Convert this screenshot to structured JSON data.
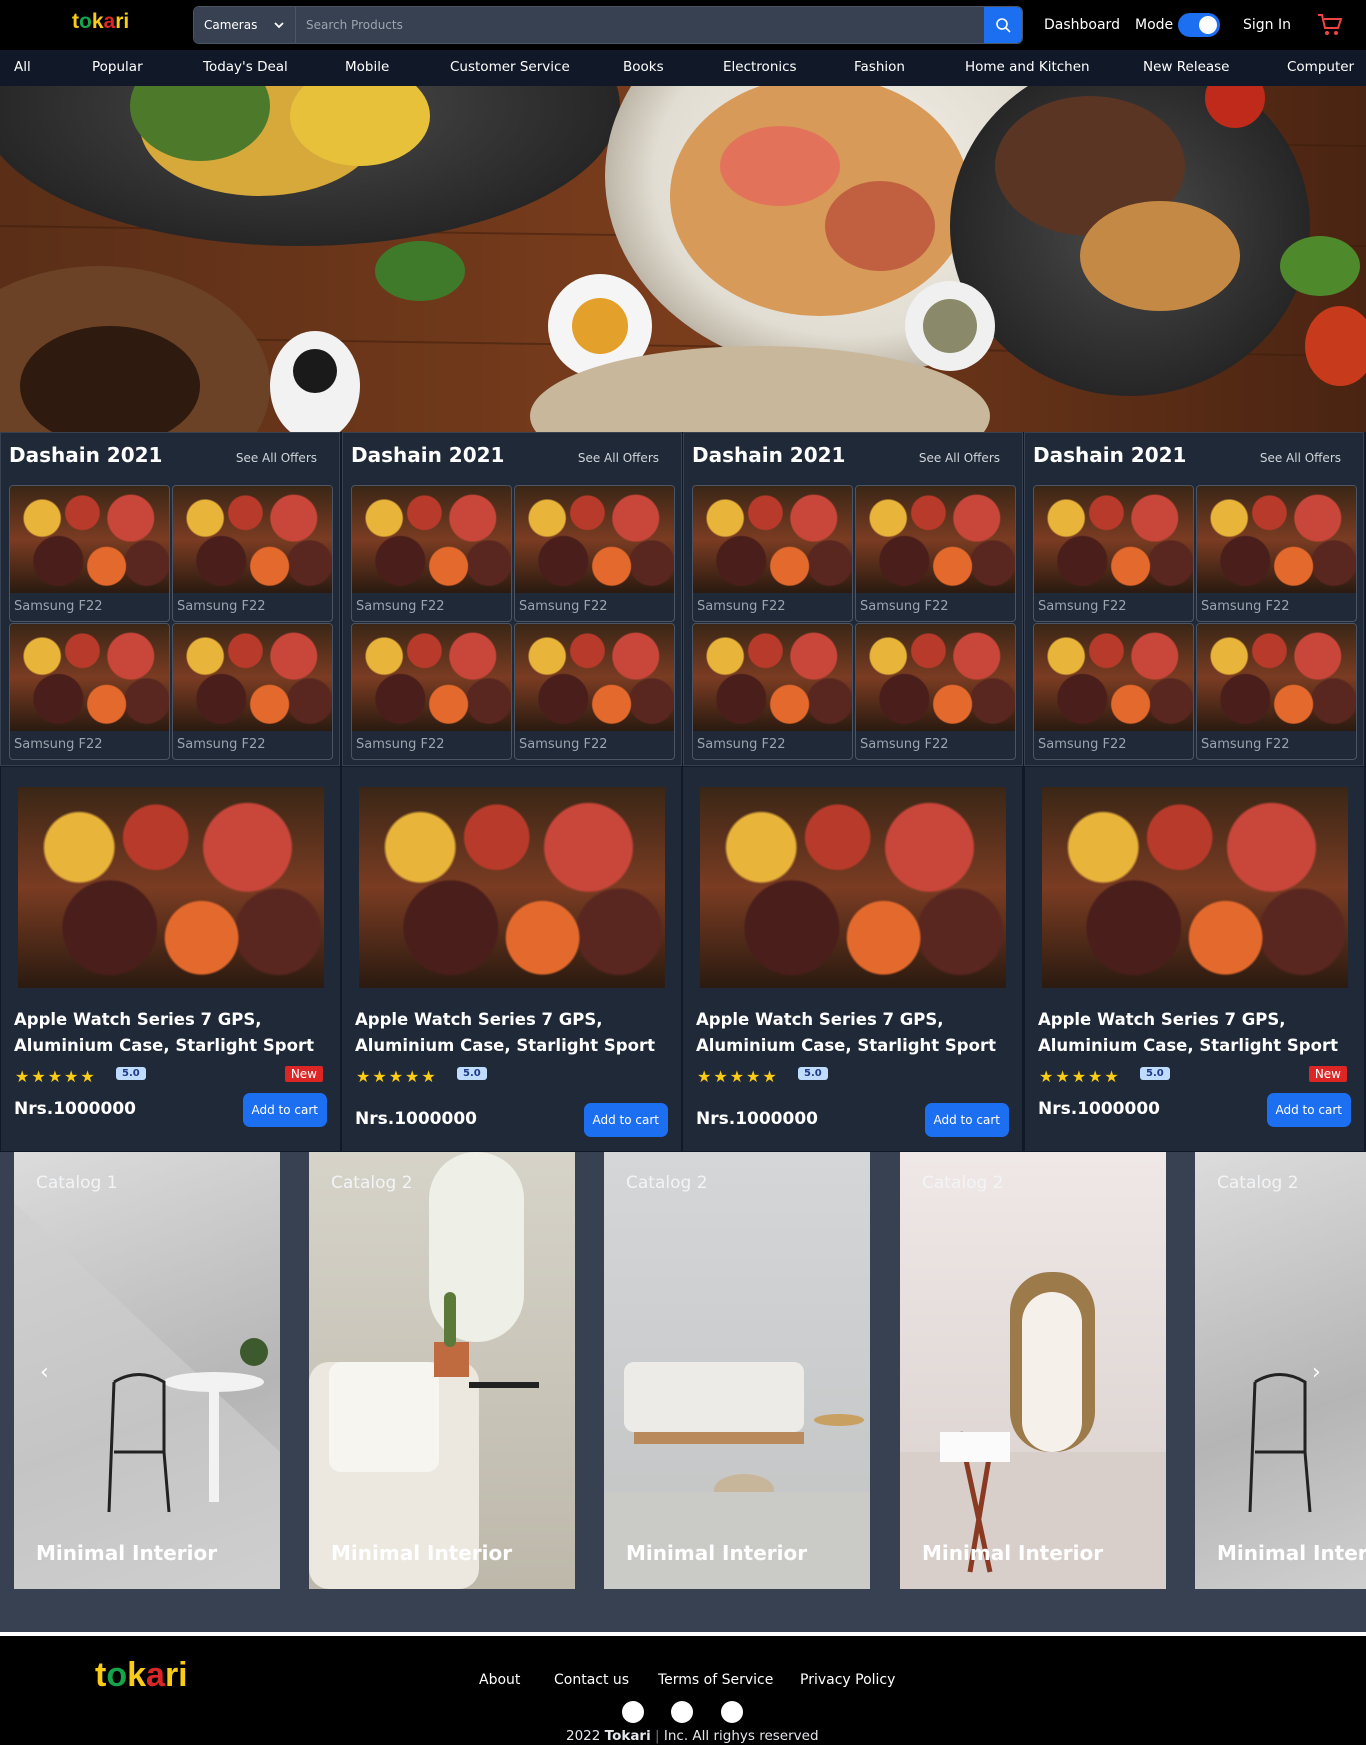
{
  "header": {
    "logo_text": "tokari",
    "search_category": "Cameras",
    "search_placeholder": "Search Products",
    "dashboard": "Dashboard",
    "mode": "Mode",
    "mode_on": true,
    "sign_in": "Sign In",
    "accent": "#1d6ff2"
  },
  "categories": [
    "All",
    "Popular",
    "Today's Deal",
    "Mobile",
    "Customer Service",
    "Books",
    "Electronics",
    "Fashion",
    "Home and Kitchen",
    "New Release",
    "Computer"
  ],
  "offers": [
    {
      "title": "Dashain 2021",
      "link": "See All Offers",
      "items": [
        "Samsung F22",
        "Samsung F22",
        "Samsung F22",
        "Samsung F22"
      ]
    },
    {
      "title": "Dashain 2021",
      "link": "See All Offers",
      "items": [
        "Samsung F22",
        "Samsung F22",
        "Samsung F22",
        "Samsung F22"
      ]
    },
    {
      "title": "Dashain 2021",
      "link": "See All Offers",
      "items": [
        "Samsung F22",
        "Samsung F22",
        "Samsung F22",
        "Samsung F22"
      ]
    },
    {
      "title": "Dashain 2021",
      "link": "See All Offers",
      "items": [
        "Samsung F22",
        "Samsung F22",
        "Samsung F22",
        "Samsung F22"
      ]
    }
  ],
  "products": [
    {
      "title": "Apple Watch Series 7 GPS, Aluminium Case, Starlight Sport",
      "stars": 5,
      "rating": "5.0",
      "badge": "New",
      "price": "Nrs.1000000",
      "cta": "Add to cart"
    },
    {
      "title": "Apple Watch Series 7 GPS, Aluminium Case, Starlight Sport",
      "stars": 5,
      "rating": "5.0",
      "badge": "",
      "price": "Nrs.1000000",
      "cta": "Add to cart"
    },
    {
      "title": "Apple Watch Series 7 GPS, Aluminium Case, Starlight Sport",
      "stars": 5,
      "rating": "5.0",
      "badge": "",
      "price": "Nrs.1000000",
      "cta": "Add to cart"
    },
    {
      "title": "Apple Watch Series 7 GPS, Aluminium Case, Starlight Sport",
      "stars": 5,
      "rating": "5.0",
      "badge": "New",
      "price": "Nrs.1000000",
      "cta": "Add to cart"
    }
  ],
  "catalog": [
    {
      "title": "Catalog 1",
      "caption": "Minimal Interior"
    },
    {
      "title": "Catalog 2",
      "caption": "Minimal Interior"
    },
    {
      "title": "Catalog 2",
      "caption": "Minimal Interior"
    },
    {
      "title": "Catalog 2",
      "caption": "Minimal Interior"
    },
    {
      "title": "Catalog 2",
      "caption": "Minimal Interior"
    }
  ],
  "footer": {
    "logo_text": "tokari",
    "links": [
      "About",
      "Contact us",
      "Terms of Service",
      "Privacy Policy"
    ],
    "social_icons": [
      "facebook-icon",
      "instagram-icon",
      "pinterest-icon"
    ],
    "copy_year": "2022",
    "copy_brand": "Tokari",
    "copy_rest": "Inc. All righys reserved"
  }
}
